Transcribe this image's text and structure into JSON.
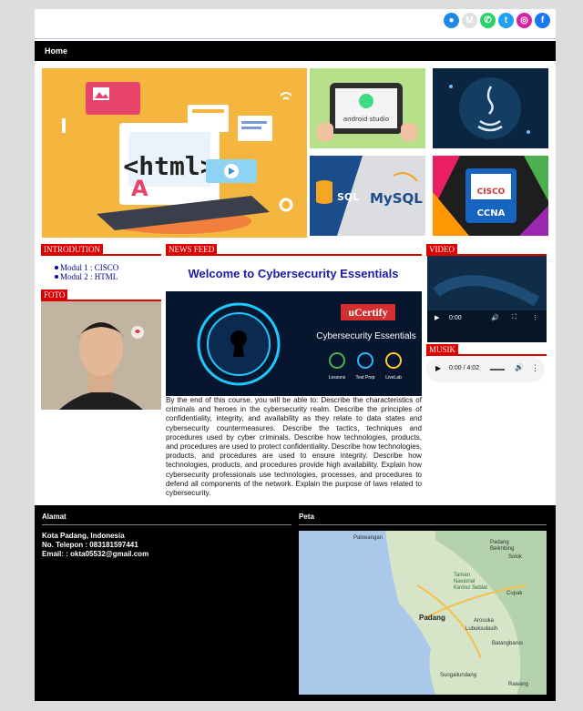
{
  "nav": {
    "home": "Home"
  },
  "social": [
    {
      "name": "globe-icon",
      "color": "#1e88e5",
      "glyph": "●"
    },
    {
      "name": "gmail-icon",
      "color": "#e0e0e0",
      "glyph": "M"
    },
    {
      "name": "whatsapp-icon",
      "color": "#25d366",
      "glyph": "✆"
    },
    {
      "name": "twitter-icon",
      "color": "#1da1f2",
      "glyph": "t"
    },
    {
      "name": "instagram-icon",
      "color": "#d6249f",
      "glyph": "◎"
    },
    {
      "name": "facebook-icon",
      "color": "#1877f2",
      "glyph": "f"
    }
  ],
  "banners": {
    "html": "<html>",
    "android": "android studio",
    "sql": "SQL",
    "mysql": "MySQL",
    "cisco": "CISCO",
    "ccna": "CCNA"
  },
  "sections": {
    "intro": "INTRODUTION",
    "foto": "FOTO",
    "news": "NEWS FEED",
    "video": "VIDEO",
    "musik": "MUSIK"
  },
  "modules": [
    "Modul 1 : CISCO",
    "Modul 2 : HTML"
  ],
  "news": {
    "title": "Welcome to Cybersecurity Essentials",
    "brand": "uCertify",
    "course": "Cybersecurity Essentials",
    "features": [
      "Lessons",
      "Test Prep",
      "LiveLab"
    ],
    "body": "By the end of this course, you will be able to: Describe the characteristics of criminals and heroes in the cybersecurity realm. Describe the principles of confidentiality, integrity, and availability as they relate to data states and cybersecurity countermeasures. Describe the tactics, techniques and procedures used by cyber criminals. Describe how technologies, products, and procedures are used to protect confidentiality. Describe how technologies, products, and procedures are used to ensure integrity. Describe how technologies, products, and procedures provide high availability. Explain how cybersecurity professionals use technologies, processes, and procedures to defend all components of the network. Explain the purpose of laws related to cybersecurity."
  },
  "video": {
    "time": "0:00"
  },
  "audio": {
    "time": "0:00 / 4:02"
  },
  "footer": {
    "alamat_title": "Alamat",
    "peta_title": "Peta",
    "address": "Kota Padang, Indonesia",
    "phone": "No. Telepon : 083181597441",
    "email": "Email: : okta05532@gmail.com"
  },
  "map_labels": {
    "paloeangan": "Paloeangan",
    "padang_belimbing": "Padang\nBelimbing",
    "solok": "Solok",
    "taman": "Taman\nNasional\nKerinci Seblat",
    "cupak": "Cupak",
    "padang": "Padang",
    "arosuka": "Arosuka",
    "lubuk": "Lubuksulasih",
    "batang": "Batangbarus",
    "sungai": "Sungailundang",
    "rawang": "Rawang"
  }
}
